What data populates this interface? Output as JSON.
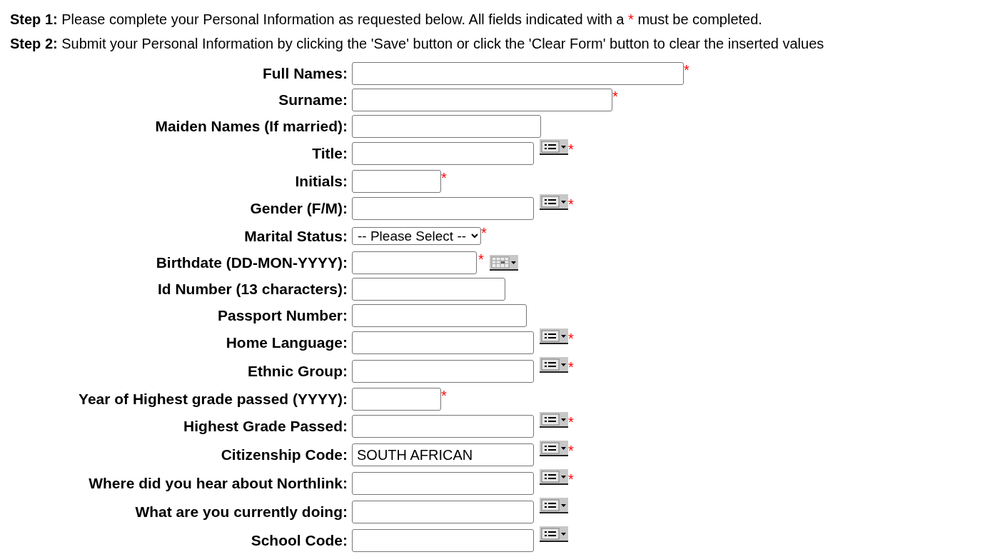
{
  "steps": [
    {
      "label": "Step 1:",
      "text_before": "Please complete your Personal Information as requested below. All fields indicated with a",
      "asterisk": "*",
      "text_after": "must be completed."
    },
    {
      "label": "Step 2:",
      "text_before": "Submit your Personal Information by clicking the 'Save' button or click the 'Clear Form' button to clear the inserted values"
    }
  ],
  "fields": [
    {
      "label": "Full Names:",
      "kind": "text",
      "required": true
    },
    {
      "label": "Surname:",
      "kind": "text",
      "required": true
    },
    {
      "label": "Maiden Names (If married):",
      "kind": "text",
      "required": false
    },
    {
      "label": "Title:",
      "kind": "lookup",
      "required": true
    },
    {
      "label": "Initials:",
      "kind": "text",
      "required": true
    },
    {
      "label": "Gender (F/M):",
      "kind": "lookup",
      "required": true
    },
    {
      "label": "Marital Status:",
      "kind": "select",
      "value": "-- Please Select --",
      "required": true
    },
    {
      "label": "Birthdate (DD-MON-YYYY):",
      "kind": "date",
      "required": true
    },
    {
      "label": "Id Number (13 characters):",
      "kind": "text",
      "required": false
    },
    {
      "label": "Passport Number:",
      "kind": "text",
      "required": false
    },
    {
      "label": "Home Language:",
      "kind": "lookup",
      "required": true
    },
    {
      "label": "Ethnic Group:",
      "kind": "lookup",
      "required": true
    },
    {
      "label": "Year of Highest grade passed (YYYY):",
      "kind": "text",
      "required": true
    },
    {
      "label": "Highest Grade Passed:",
      "kind": "lookup",
      "required": true
    },
    {
      "label": "Citizenship Code:",
      "kind": "lookup",
      "value": "SOUTH AFRICAN",
      "required": true
    },
    {
      "label": "Where did you hear about Northlink:",
      "kind": "lookup",
      "required": true
    },
    {
      "label": "What are you currently doing:",
      "kind": "lookup",
      "required": false
    },
    {
      "label": "School Code:",
      "kind": "lookup",
      "required": false
    }
  ]
}
